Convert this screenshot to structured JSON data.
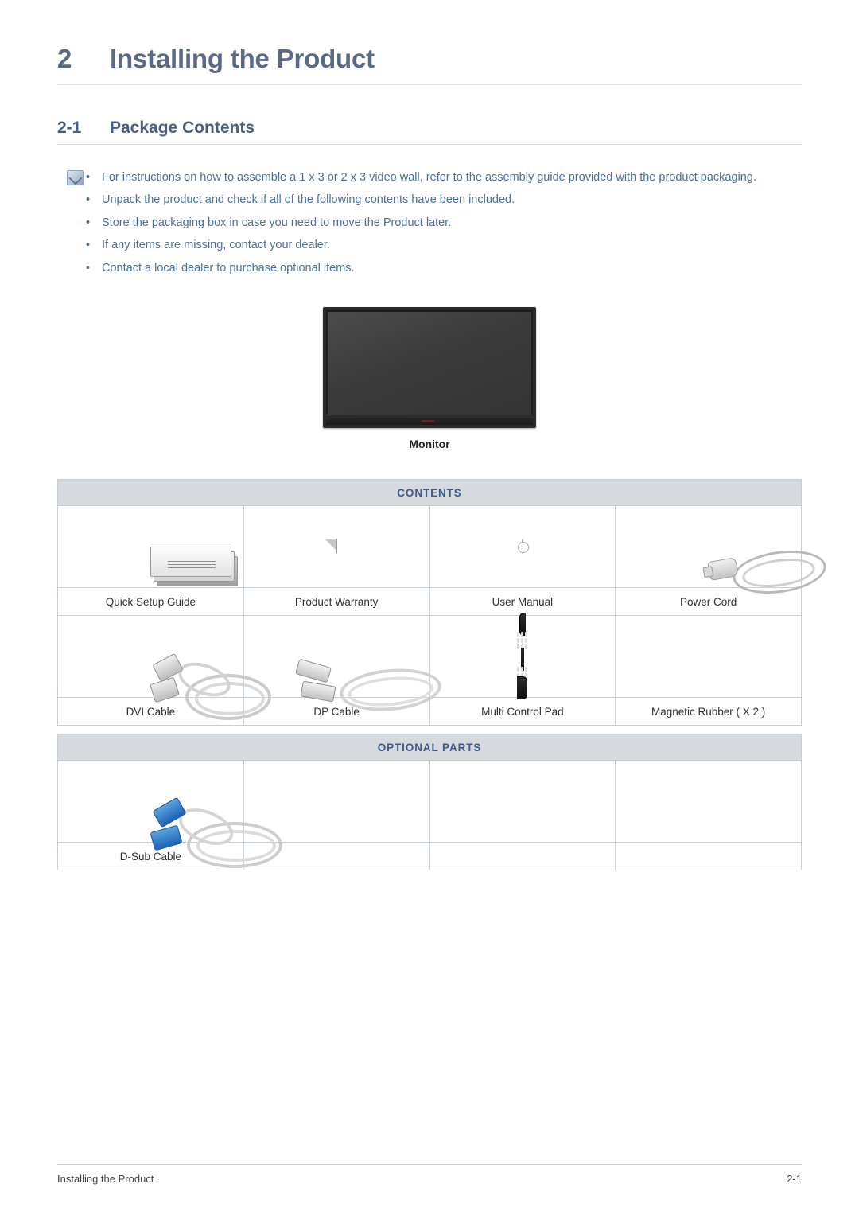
{
  "chapter": {
    "number": "2",
    "title": "Installing the Product"
  },
  "section": {
    "number": "2-1",
    "title": "Package Contents"
  },
  "notes": [
    "For instructions on how to assemble a 1 x 3 or 2 x 3 video wall, refer to the assembly guide provided with the product packaging.",
    "Unpack the product and check if all of the following contents have been included.",
    "Store the packaging box in case you need to move the Product later.",
    "If any items are missing, contact your dealer.",
    "Contact a local dealer to purchase optional items."
  ],
  "bullet_char": "•",
  "monitor": {
    "label": "Monitor"
  },
  "contents_table": {
    "header": "CONTENTS",
    "rows": [
      [
        "Quick Setup Guide",
        "Product Warranty",
        "User Manual",
        "Power Cord"
      ],
      [
        "DVI Cable",
        "DP Cable",
        "Multi Control Pad",
        "Magnetic Rubber ( X 2 )"
      ]
    ]
  },
  "optional_table": {
    "header": "OPTIONAL PARTS",
    "rows": [
      [
        "D-Sub Cable",
        "",
        "",
        ""
      ]
    ]
  },
  "footer": {
    "left": "Installing the Product",
    "right": "2-1"
  }
}
